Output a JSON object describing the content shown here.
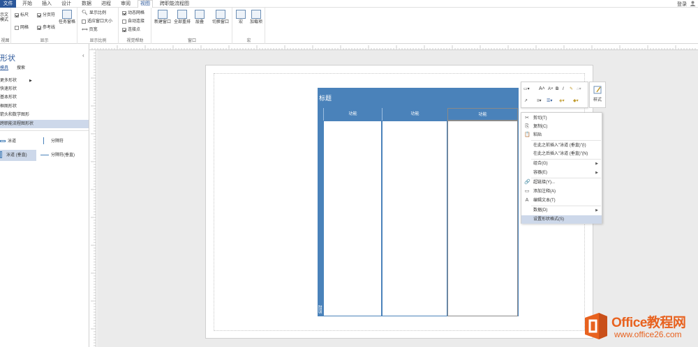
{
  "tabs": [
    {
      "label": "文件"
    },
    {
      "label": "开始"
    },
    {
      "label": "插入"
    },
    {
      "label": "设计"
    },
    {
      "label": "数据"
    },
    {
      "label": "进程"
    },
    {
      "label": "审阅"
    },
    {
      "label": "视图"
    },
    {
      "label": "跨职能流程图"
    }
  ],
  "active_tab": "视图",
  "login": "登录",
  "ribbon": {
    "view_group": {
      "btn": "示文\n模式",
      "label": "视图"
    },
    "show_group": {
      "ruler": "标尺",
      "pagebreak": "分页符",
      "grid": "网格",
      "guides": "参考线",
      "taskpane": "任务窗格",
      "label": "显示"
    },
    "zoom_group": {
      "zoom": "显示比例",
      "fit": "适应窗口大小",
      "page": "页宽",
      "label": "显示比例"
    },
    "visual_group": {
      "dyngrid": "动态网格",
      "autoconn": "自动连接",
      "connpts": "连接点",
      "label": "视觉帮助"
    },
    "window_group": {
      "new": "新建窗口",
      "all": "全部重排",
      "cascade": "层叠",
      "switch": "切换窗口",
      "label": "窗口"
    },
    "macro_group": {
      "macro": "宏",
      "addin": "加载项",
      "label": "宏"
    }
  },
  "pane": {
    "title": "形状",
    "tabs": [
      "模具",
      "搜索"
    ],
    "stencils": [
      "更多形状",
      "快速形状",
      "基本形状",
      "框图形状",
      "箭头和数学图形",
      "跨职能流程图形状"
    ],
    "shapes": [
      "泳道",
      "分隔符",
      "泳道 (垂直)",
      "分隔符(垂直)"
    ]
  },
  "diagram": {
    "title": "标题",
    "lanes": [
      "功能",
      "功能",
      "功能"
    ],
    "phase": "阶段"
  },
  "mini_toolbar": {
    "style": "样式"
  },
  "context_menu": [
    {
      "label": "剪切(T)",
      "icon": "✂"
    },
    {
      "label": "复制(C)",
      "icon": "⎘"
    },
    {
      "label": "粘贴",
      "icon": "📋"
    },
    {
      "label": "在此之前插入\"泳道 (垂直)\"(I)",
      "icon": ""
    },
    {
      "label": "在此之后插入\"泳道 (垂直)\"(N)",
      "icon": ""
    },
    {
      "label": "组合(G)",
      "icon": "",
      "arrow": true
    },
    {
      "label": "容器(E)",
      "icon": "",
      "arrow": true
    },
    {
      "label": "超链接(Y)...",
      "icon": "🔗"
    },
    {
      "label": "添加注释(A)",
      "icon": "▭"
    },
    {
      "label": "编辑文本(T)",
      "icon": "A"
    },
    {
      "label": "数据(D)",
      "icon": "",
      "arrow": true
    },
    {
      "label": "设置形状格式(S)",
      "icon": ""
    }
  ],
  "watermark": {
    "brand": "Office教程网",
    "url": "www.office26.com"
  }
}
